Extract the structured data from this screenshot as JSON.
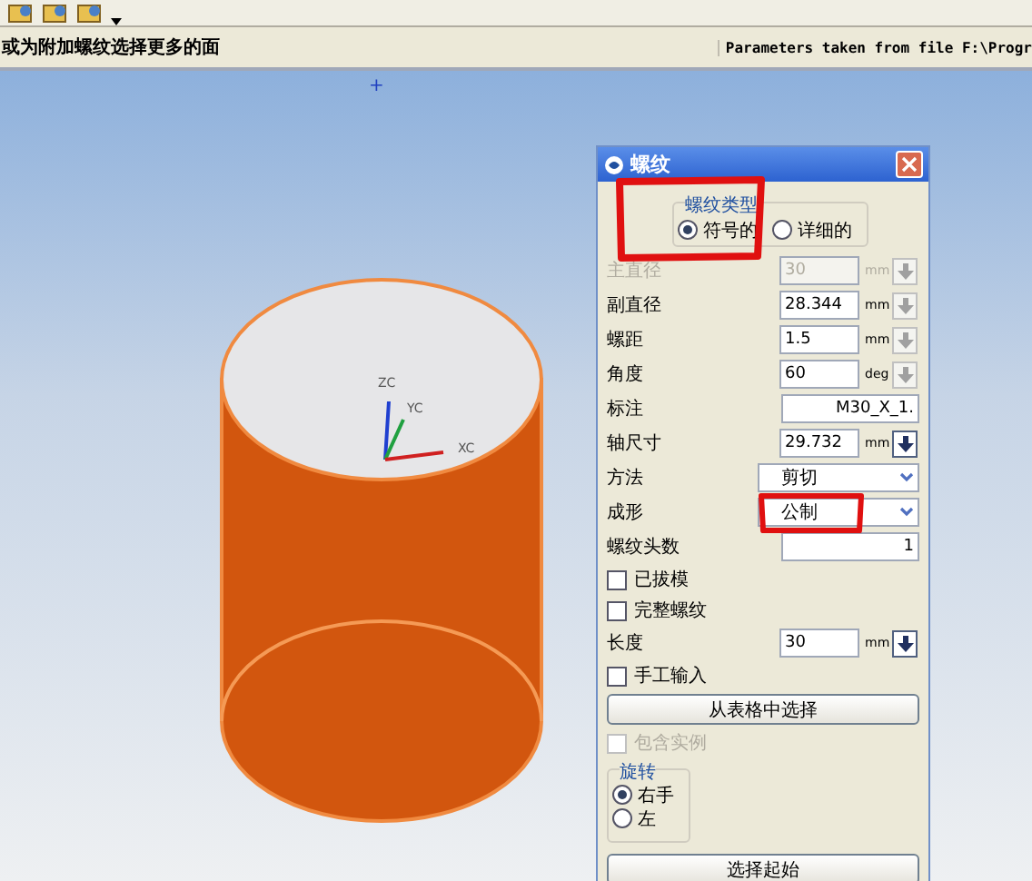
{
  "status_bar": {
    "prompt": "或为附加螺纹选择更多的面",
    "message": "Parameters taken from file  F:\\Progr"
  },
  "viewport": {
    "cursor": "+",
    "axes": [
      "ZC",
      "YC",
      "XC"
    ]
  },
  "dialog": {
    "title": "螺纹",
    "thread_type": {
      "label": "螺纹类型",
      "options": [
        {
          "label": "符号的",
          "selected": true
        },
        {
          "label": "详细的",
          "selected": false
        }
      ]
    },
    "rows": [
      {
        "kind": "field",
        "label": "主直径",
        "value": "30",
        "unit": "mm",
        "disabled": true
      },
      {
        "kind": "field",
        "label": "副直径",
        "value": "28.344",
        "unit": "mm",
        "disabled": false
      },
      {
        "kind": "field",
        "label": "螺距",
        "value": "1.5",
        "unit": "mm",
        "disabled": false
      },
      {
        "kind": "field",
        "label": "角度",
        "value": "60",
        "unit": "deg",
        "disabled": false
      },
      {
        "kind": "text",
        "label": "标注",
        "value": "M30_X_1."
      },
      {
        "kind": "field",
        "label": "轴尺寸",
        "value": "29.732",
        "unit": "mm",
        "disabled": false,
        "active": true
      },
      {
        "kind": "dropdown",
        "label": "方法",
        "value": "剪切"
      },
      {
        "kind": "dropdown",
        "label": "成形",
        "value": "公制"
      },
      {
        "kind": "text",
        "label": "螺纹头数",
        "value": "1"
      },
      {
        "kind": "checkbox",
        "label": "已拔模",
        "checked": false,
        "disabled": false
      },
      {
        "kind": "checkbox",
        "label": "完整螺纹",
        "checked": false,
        "disabled": false
      },
      {
        "kind": "field",
        "label": "长度",
        "value": "30",
        "unit": "mm",
        "disabled": false,
        "active": true
      },
      {
        "kind": "checkbox",
        "label": "手工输入",
        "checked": false,
        "disabled": false
      },
      {
        "kind": "button",
        "label": "从表格中选择"
      },
      {
        "kind": "checkbox",
        "label": "包含实例",
        "checked": false,
        "disabled": true
      },
      {
        "kind": "radios",
        "label": "旋转",
        "options": [
          {
            "label": "右手",
            "selected": true
          },
          {
            "label": "左",
            "selected": false
          }
        ]
      },
      {
        "kind": "button",
        "label": "选择起始"
      }
    ]
  }
}
